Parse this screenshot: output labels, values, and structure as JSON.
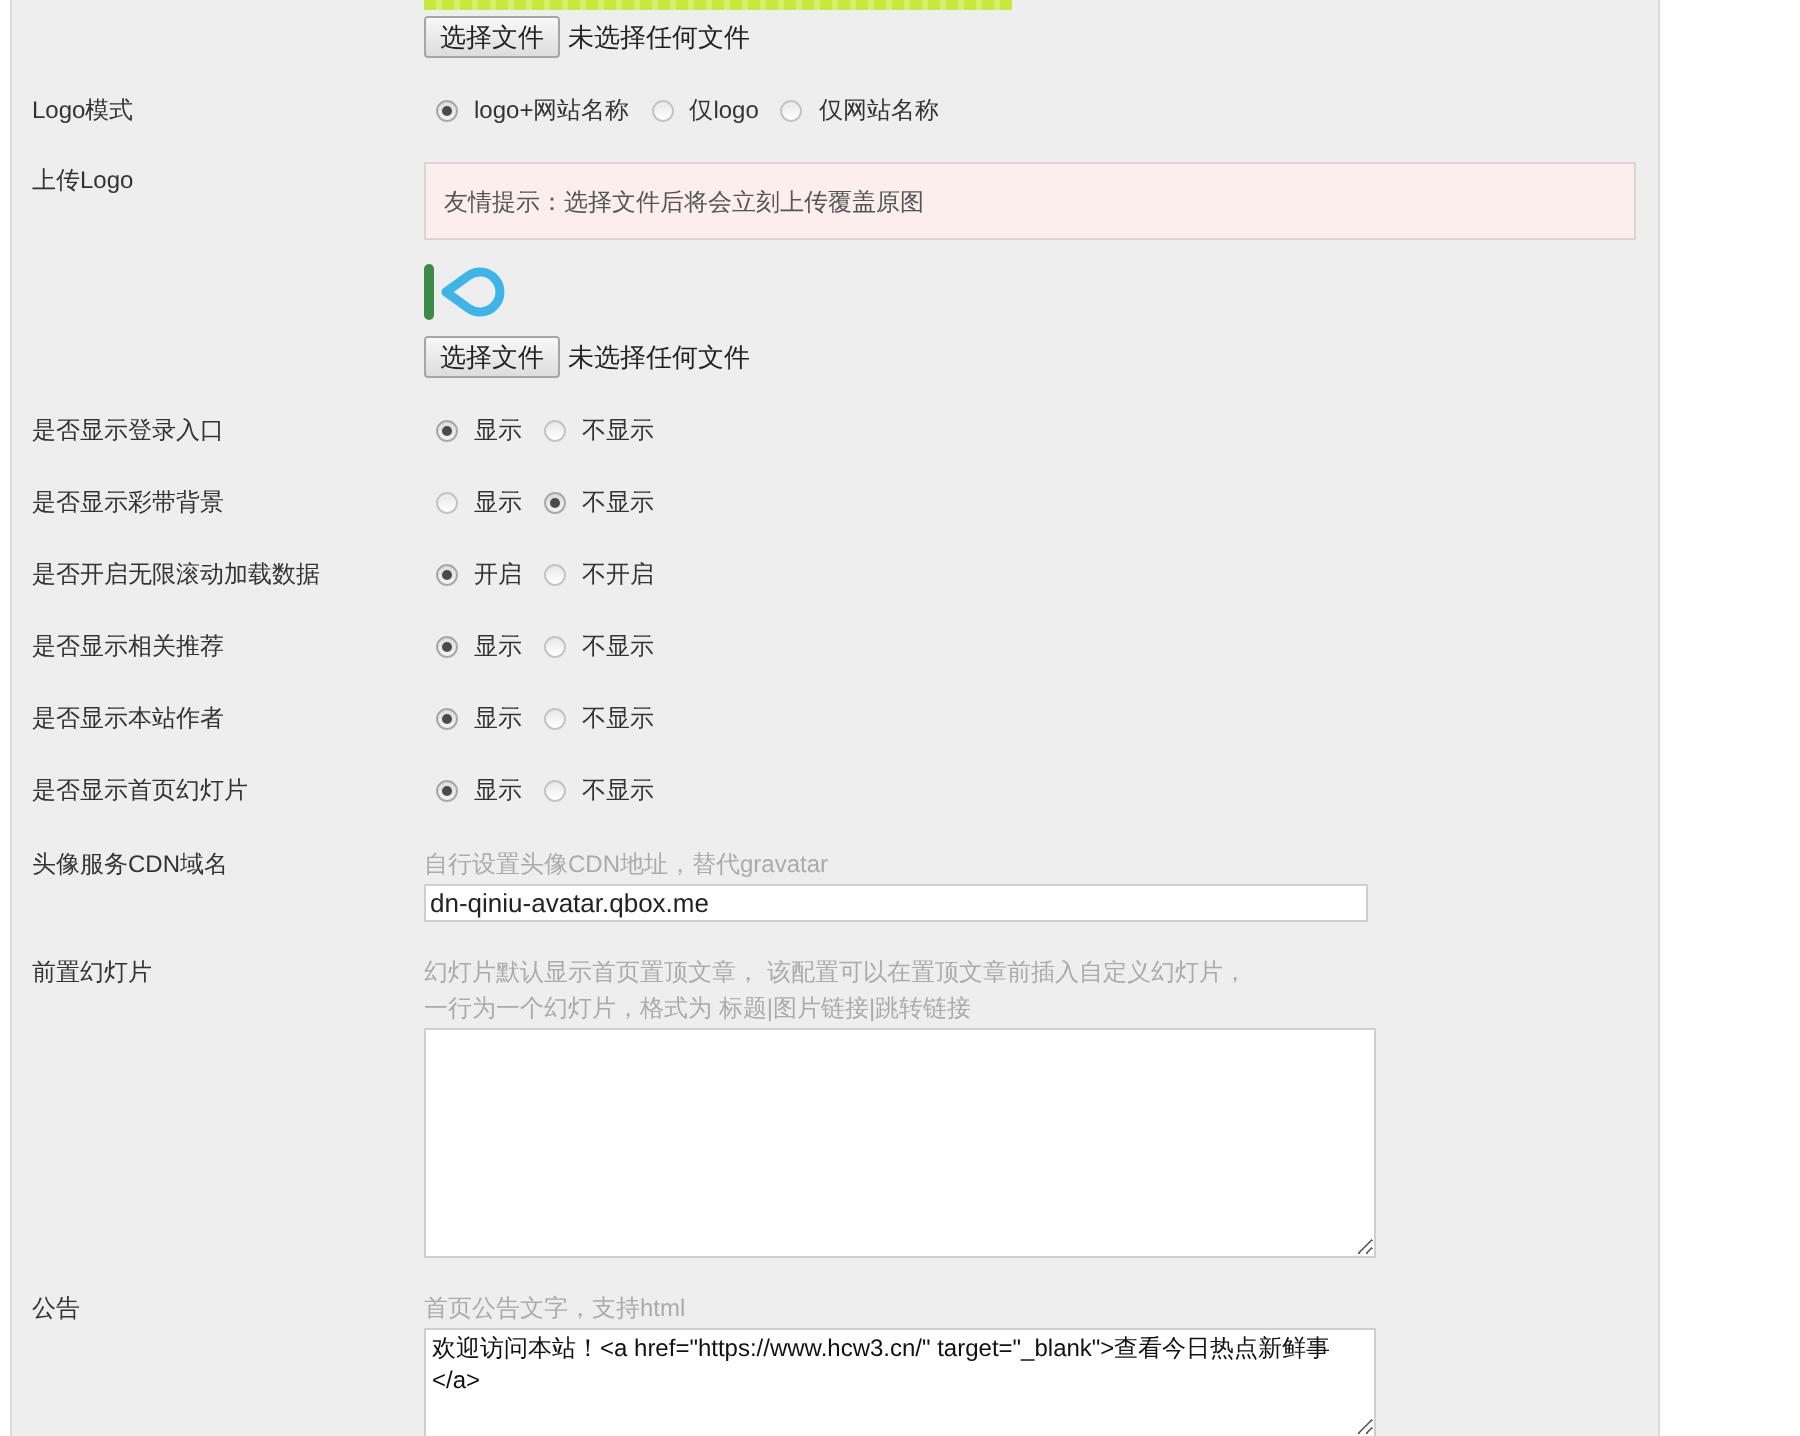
{
  "settings": [
    {
      "kind": "file",
      "preview": {
        "kind": "image"
      },
      "button": "选择文件",
      "status": "未选择任何文件"
    },
    {
      "kind": "radio",
      "label": "Logo模式",
      "options": [
        {
          "label": "logo+网站名称",
          "selected": true
        },
        {
          "label": "仅logo",
          "selected": false
        },
        {
          "label": "仅网站名称",
          "selected": false
        }
      ]
    },
    {
      "kind": "file",
      "label": "上传Logo",
      "notice": "友情提示：选择文件后将会立刻上传覆盖原图",
      "preview": {
        "kind": "logo"
      },
      "button": "选择文件",
      "status": "未选择任何文件"
    },
    {
      "kind": "radio",
      "label": "是否显示登录入口",
      "options": [
        {
          "label": "显示",
          "selected": true
        },
        {
          "label": "不显示",
          "selected": false
        }
      ]
    },
    {
      "kind": "radio",
      "label": "是否显示彩带背景",
      "options": [
        {
          "label": "显示",
          "selected": false
        },
        {
          "label": "不显示",
          "selected": true
        }
      ]
    },
    {
      "kind": "radio",
      "label": "是否开启无限滚动加载数据",
      "options": [
        {
          "label": "开启",
          "selected": true
        },
        {
          "label": "不开启",
          "selected": false
        }
      ]
    },
    {
      "kind": "radio",
      "label": "是否显示相关推荐",
      "options": [
        {
          "label": "显示",
          "selected": true
        },
        {
          "label": "不显示",
          "selected": false
        }
      ]
    },
    {
      "kind": "radio",
      "label": "是否显示本站作者",
      "options": [
        {
          "label": "显示",
          "selected": true
        },
        {
          "label": "不显示",
          "selected": false
        }
      ]
    },
    {
      "kind": "radio",
      "label": "是否显示首页幻灯片",
      "options": [
        {
          "label": "显示",
          "selected": true
        },
        {
          "label": "不显示",
          "selected": false
        }
      ]
    },
    {
      "kind": "text",
      "label": "头像服务CDN域名",
      "hint": [
        "自行设置头像CDN地址，替代gravatar"
      ],
      "value": "dn-qiniu-avatar.qbox.me"
    },
    {
      "kind": "textarea",
      "label": "前置幻灯片",
      "hint": [
        "幻灯片默认显示首页置顶文章， 该配置可以在置顶文章前插入自定义幻灯片，",
        "一行为一个幻灯片，格式为 标题|图片链接|跳转链接"
      ]
    },
    {
      "kind": "textarea",
      "label": "公告",
      "hint": [
        "首页公告文字，支持html"
      ],
      "value": "欢迎访问本站！<a href=\"https://www.hcw3.cn/\" target=\"_blank\">查看今日热点新鲜事</a>"
    }
  ]
}
